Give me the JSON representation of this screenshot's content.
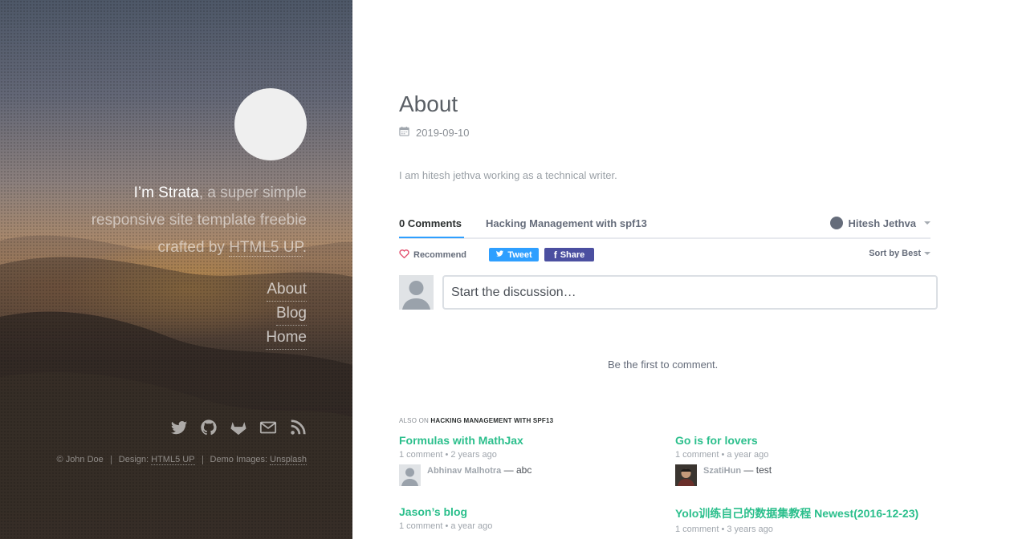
{
  "sidebar": {
    "intro_name": "I’m Strata",
    "intro_rest": ", a super simple responsive site template freebie crafted by ",
    "intro_link": "HTML5 UP",
    "intro_end": ".",
    "nav": [
      "About",
      "Blog",
      "Home"
    ],
    "social_icons": [
      "twitter-icon",
      "github-icon",
      "gitlab-icon",
      "envelope-icon",
      "rss-icon"
    ],
    "footer": {
      "copyright": "© John Doe",
      "design_label": "Design: ",
      "design_link": "HTML5 UP",
      "demo_label": "Demo Images: ",
      "demo_link": "Unsplash"
    }
  },
  "main": {
    "title": "About",
    "date_icon": "calendar-icon",
    "date": "2019-09-10",
    "body": "I am hitesh jethva working as a technical writer."
  },
  "disqus": {
    "comments_tab": "0 Comments",
    "forum_tab": "Hacking Management with spf13",
    "user_name": "Hitesh Jethva",
    "recommend": "Recommend",
    "tweet": "Tweet",
    "share": "Share",
    "sort": "Sort by Best",
    "compose_placeholder": "Start the discussion…",
    "empty_text": "Be the first to comment.",
    "also_on_prefix": "ALSO ON ",
    "also_on_site": "HACKING MANAGEMENT WITH SPF13",
    "accent": "#2e9fff",
    "link_color": "#2bbf8c",
    "recommendations": [
      {
        "title": "Formulas with MathJax",
        "meta": "1 comment • 2 years ago",
        "author": "Abhinav Malhotra",
        "text": " — abc"
      },
      {
        "title": "Go is for lovers",
        "meta": "1 comment • a year ago",
        "author": "SzatiHun",
        "text": " — test"
      },
      {
        "title": "Jason’s blog",
        "meta": "1 comment • a year ago",
        "author": "",
        "text": ""
      },
      {
        "title": "Yolo训练自己的数据集教程 Newest(2016-12-23)",
        "meta": "1 comment • 3 years ago",
        "author": "",
        "text": ""
      }
    ]
  }
}
